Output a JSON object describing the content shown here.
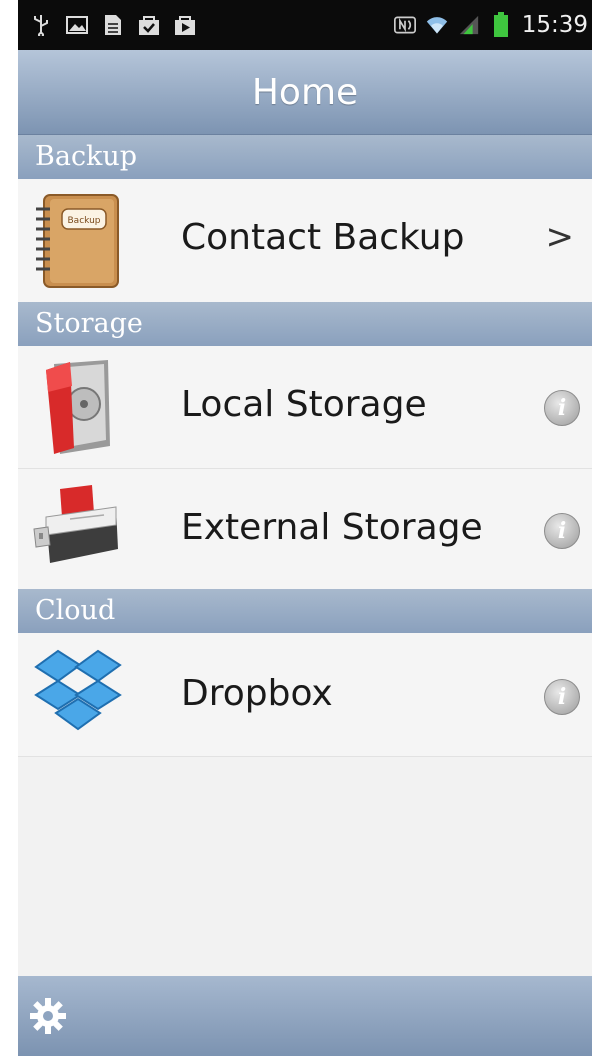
{
  "statusbar": {
    "left_icons": [
      "usb-icon",
      "image-icon",
      "document-icon",
      "checkbox-bag-icon",
      "play-bag-icon"
    ],
    "right_icons": [
      "nfc-icon",
      "wifi-icon",
      "signal-icon",
      "battery-icon"
    ],
    "time": "15:39",
    "battery_color": "#3fc63f"
  },
  "header": {
    "title": "Home"
  },
  "sections": [
    {
      "title": "Backup",
      "items": [
        {
          "label": "Contact Backup",
          "icon": "address-book-icon",
          "icon_text": "Backup",
          "accessory": "chevron",
          "chevron": ">"
        }
      ]
    },
    {
      "title": "Storage",
      "items": [
        {
          "label": "Local Storage",
          "icon": "phone-storage-icon",
          "accessory": "info",
          "info": "i"
        },
        {
          "label": "External Storage",
          "icon": "usb-drive-icon",
          "accessory": "info",
          "info": "i"
        }
      ]
    },
    {
      "title": "Cloud",
      "items": [
        {
          "label": "Dropbox",
          "icon": "dropbox-icon",
          "accessory": "info",
          "info": "i"
        }
      ]
    }
  ],
  "footer": {
    "icon": "gear-icon"
  },
  "colors": {
    "titlebar": "#8fa5c1",
    "section": "#98acc4",
    "row_bg": "#f5f5f5"
  }
}
